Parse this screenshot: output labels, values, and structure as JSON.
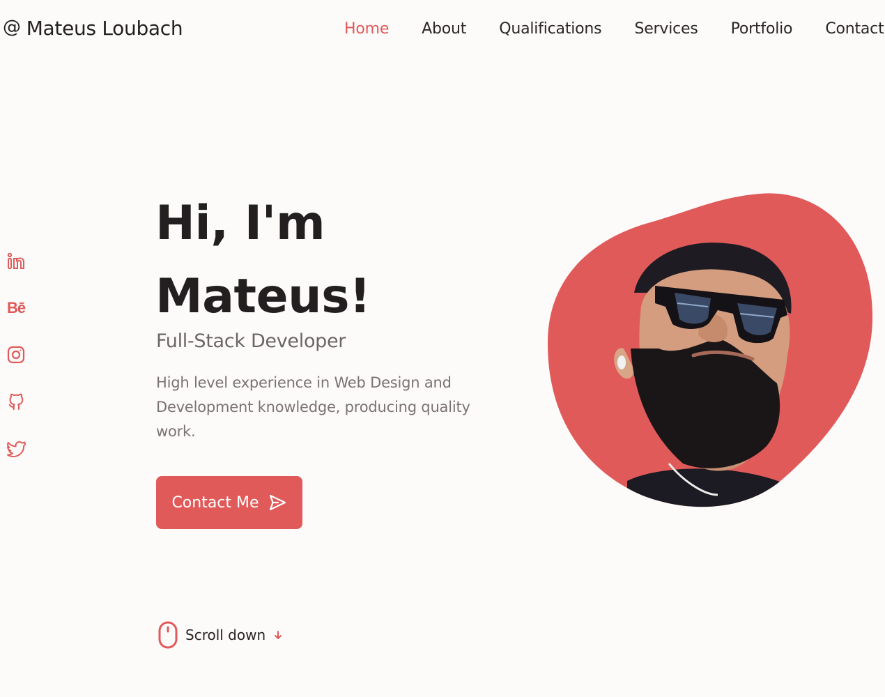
{
  "header": {
    "brand_symbol": "@",
    "brand_name": "Mateus Loubach",
    "nav": [
      {
        "label": "Home",
        "active": true
      },
      {
        "label": "About",
        "active": false
      },
      {
        "label": "Qualifications",
        "active": false
      },
      {
        "label": "Services",
        "active": false
      },
      {
        "label": "Portfolio",
        "active": false
      },
      {
        "label": "Contact",
        "active": false
      }
    ]
  },
  "socials": [
    {
      "icon": "linkedin-icon"
    },
    {
      "icon": "behance-icon",
      "glyph": "Bē"
    },
    {
      "icon": "instagram-icon"
    },
    {
      "icon": "github-icon"
    },
    {
      "icon": "twitter-icon"
    }
  ],
  "hero": {
    "title_line1": "Hi, I'm",
    "title_line2": "Mateus!",
    "subtitle": "Full-Stack Developer",
    "description": "High level experience in Web Design and Development knowledge, producing quality work.",
    "cta_label": "Contact Me",
    "cta_icon": "send-icon",
    "scroll_label": "Scroll down",
    "scroll_icon": "mouse-icon",
    "scroll_arrow_icon": "arrow-down-icon"
  },
  "colors": {
    "accent": "#e05a5a",
    "text": "#231f20",
    "muted": "#7a7273",
    "background": "#fdfbfa"
  }
}
